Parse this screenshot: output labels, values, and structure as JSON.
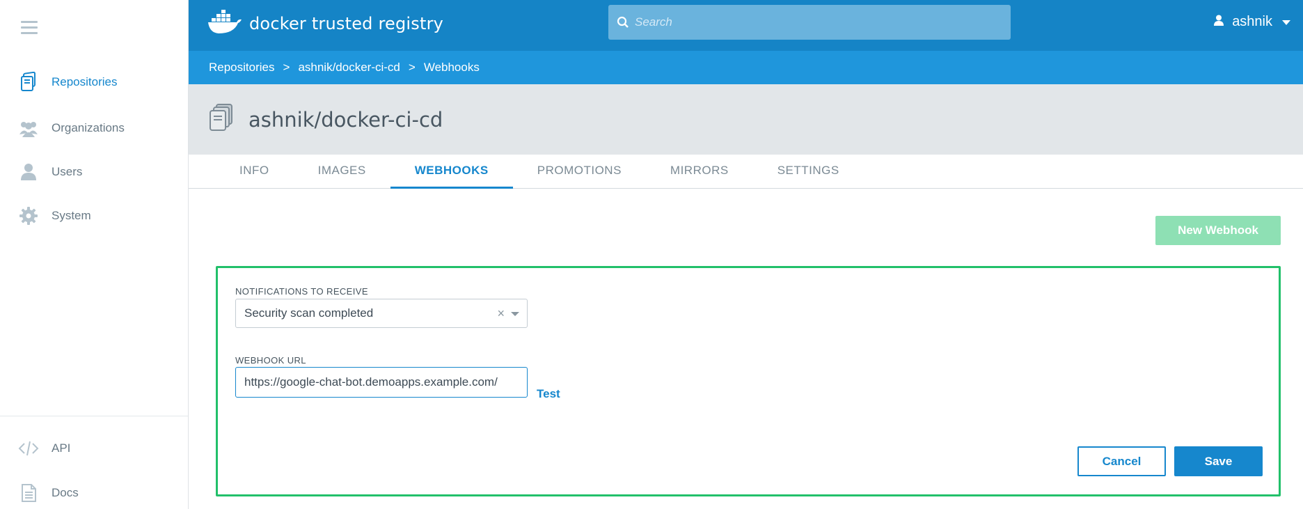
{
  "app": {
    "logo_text": "docker trusted registry",
    "search_placeholder": "Search",
    "username": "ashnik"
  },
  "sidebar": {
    "items": [
      {
        "label": "Repositories",
        "icon": "repositories-icon",
        "active": true
      },
      {
        "label": "Organizations",
        "icon": "organizations-icon",
        "active": false
      },
      {
        "label": "Users",
        "icon": "user-icon",
        "active": false
      },
      {
        "label": "System",
        "icon": "gear-icon",
        "active": false
      }
    ],
    "bottom_items": [
      {
        "label": "API",
        "icon": "code-icon"
      },
      {
        "label": "Docs",
        "icon": "document-icon"
      }
    ]
  },
  "breadcrumb": [
    "Repositories",
    "ashnik/docker-ci-cd",
    "Webhooks"
  ],
  "repo": {
    "title": "ashnik/docker-ci-cd"
  },
  "tabs": [
    "INFO",
    "IMAGES",
    "WEBHOOKS",
    "PROMOTIONS",
    "MIRRORS",
    "SETTINGS"
  ],
  "active_tab": "WEBHOOKS",
  "actions": {
    "new_webhook": "New Webhook"
  },
  "form": {
    "notifications_label": "NOTIFICATIONS TO RECEIVE",
    "notifications_value": "Security scan completed",
    "clear_symbol": "×",
    "webhook_url_label": "WEBHOOK URL",
    "webhook_url_value": "https://google-chat-bot.demoapps.example.com/",
    "test_label": "Test",
    "cancel_label": "Cancel",
    "save_label": "Save"
  },
  "colors": {
    "topbar": "#1584c6",
    "breadcrumb_bar": "#1f96dc",
    "accent": "#1687cd",
    "panel_border": "#22c06a",
    "new_webhook_button": "#8ee0b4"
  }
}
